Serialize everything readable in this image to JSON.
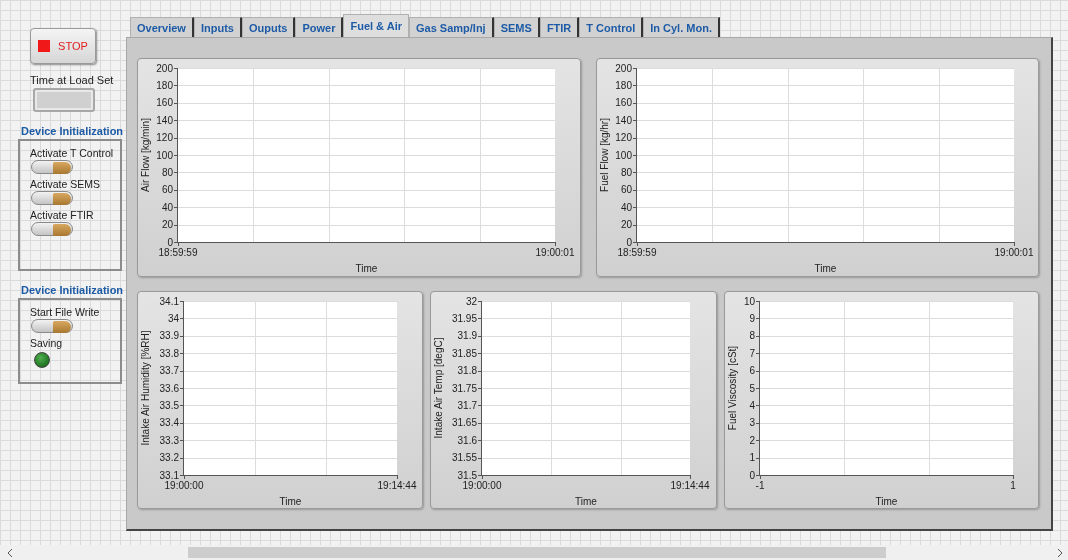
{
  "stop_button": {
    "label": "STOP"
  },
  "time_at_load_set": {
    "label": "Time at Load Set"
  },
  "device_groups": [
    {
      "title": "Device Initialization",
      "controls": [
        {
          "kind": "toggle",
          "label": "Activate T Control",
          "on": true
        },
        {
          "kind": "toggle",
          "label": "Activate SEMS",
          "on": true
        },
        {
          "kind": "toggle",
          "label": "Activate FTIR",
          "on": true
        }
      ]
    },
    {
      "title": "Device Initialization",
      "controls": [
        {
          "kind": "toggle",
          "label": "Start File Write",
          "on": true
        },
        {
          "kind": "led",
          "label": "Saving",
          "on": false
        }
      ]
    }
  ],
  "tabs": [
    {
      "label": "Overview",
      "selected": false
    },
    {
      "label": "Inputs",
      "selected": false
    },
    {
      "label": "Ouputs",
      "selected": false
    },
    {
      "label": "Power",
      "selected": false
    },
    {
      "label": "Fuel & Air",
      "selected": true
    },
    {
      "label": "Gas Samp/Inj",
      "selected": false
    },
    {
      "label": "SEMS",
      "selected": false
    },
    {
      "label": "FTIR",
      "selected": false
    },
    {
      "label": "T Control",
      "selected": false
    },
    {
      "label": "In Cyl. Mon.",
      "selected": false
    }
  ],
  "charts": [
    {
      "chart_data": {
        "type": "line",
        "xlabel": "Time",
        "ylabel": "Air Flow [kg/min]",
        "grid": true,
        "xlim": [
          68399,
          68401
        ],
        "ylim": [
          0,
          200
        ],
        "xticks": [
          {
            "value": 68399,
            "label": "18:59:59"
          },
          {
            "value": 68401,
            "label": "19:00:01"
          }
        ],
        "yticks": [
          0,
          20,
          40,
          60,
          80,
          100,
          120,
          140,
          160,
          180,
          200
        ]
      }
    },
    {
      "chart_data": {
        "type": "line",
        "xlabel": "Time",
        "ylabel": "Fuel Flow [kg/hr]",
        "grid": true,
        "xlim": [
          68399,
          68401
        ],
        "ylim": [
          0,
          200
        ],
        "xticks": [
          {
            "value": 68399,
            "label": "18:59:59"
          },
          {
            "value": 68401,
            "label": "19:00:01"
          }
        ],
        "yticks": [
          0,
          20,
          40,
          60,
          80,
          100,
          120,
          140,
          160,
          180,
          200
        ]
      }
    },
    {
      "chart_data": {
        "type": "line",
        "xlabel": "Time",
        "ylabel": "Intake Air Humidity [%RH]",
        "grid": true,
        "xlim": [
          68400,
          69284
        ],
        "ylim": [
          33.1,
          34.1
        ],
        "xticks": [
          {
            "value": 68400,
            "label": "19:00:00"
          },
          {
            "value": 69284,
            "label": "19:14:44"
          }
        ],
        "yticks": [
          33.1,
          33.2,
          33.3,
          33.4,
          33.5,
          33.6,
          33.7,
          33.8,
          33.9,
          34,
          34.1
        ]
      }
    },
    {
      "chart_data": {
        "type": "line",
        "xlabel": "Time",
        "ylabel": "Intake Air Temp [degC]",
        "grid": true,
        "xlim": [
          68400,
          69284
        ],
        "ylim": [
          31.5,
          32
        ],
        "xticks": [
          {
            "value": 68400,
            "label": "19:00:00"
          },
          {
            "value": 69284,
            "label": "19:14:44"
          }
        ],
        "yticks": [
          31.5,
          31.55,
          31.6,
          31.65,
          31.7,
          31.75,
          31.8,
          31.85,
          31.9,
          31.95,
          32
        ]
      }
    },
    {
      "chart_data": {
        "type": "line",
        "xlabel": "Time",
        "ylabel": "Fuel Viscosity [cSt]",
        "grid": true,
        "xlim": [
          -1,
          1
        ],
        "ylim": [
          0,
          10
        ],
        "xticks": [
          -1,
          1
        ],
        "yticks": [
          0,
          1,
          2,
          3,
          4,
          5,
          6,
          7,
          8,
          9,
          10
        ]
      }
    }
  ]
}
